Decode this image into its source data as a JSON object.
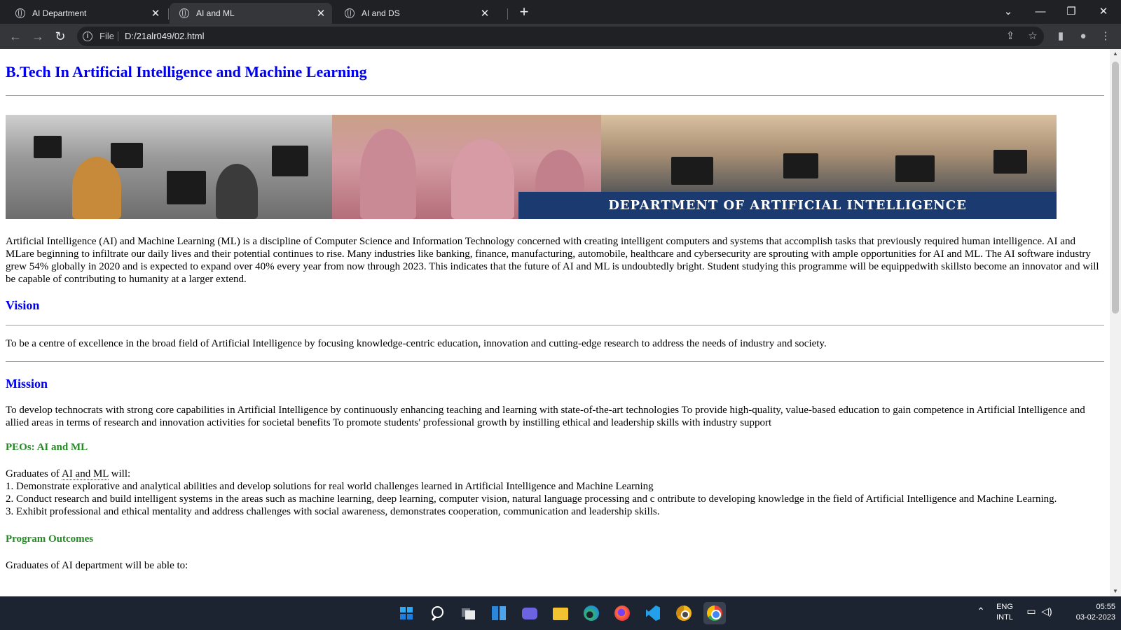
{
  "tabs": [
    {
      "label": "AI Department",
      "active": false
    },
    {
      "label": "AI and ML",
      "active": true
    },
    {
      "label": "AI and DS",
      "active": false
    }
  ],
  "toolbar": {
    "scheme": "File",
    "url": "D:/21alr049/02.html"
  },
  "page": {
    "title": "B.Tech In Artificial Intelligence and Machine Learning",
    "banner_caption": "DEPARTMENT OF ARTIFICIAL INTELLIGENCE",
    "intro": "Artificial Intelligence (AI) and Machine Learning (ML) is a discipline of Computer Science and Information Technology concerned with creating intelligent computers and systems that accomplish tasks that previously required human intelligence. AI and MLare beginning to infiltrate our daily lives and their potential continues to rise. Many industries like banking, finance, manufacturing, automobile, healthcare and cybersecurity are sprouting with ample opportunities for AI and ML. The AI software industry grew 54% globally in 2020 and is expected to expand over 40% every year from now through 2023. This indicates that the future of AI and ML is undoubtedly bright. Student studying this programme will be equippedwith skillsto become an innovator and will be capable of contributing to humanity at a larger extend.",
    "vision_heading": "Vision",
    "vision_text": "To be a centre of excellence in the broad field of Artificial Intelligence by focusing knowledge-centric education, innovation and cutting-edge research to address the needs of industry and society.",
    "mission_heading": "Mission",
    "mission_text": "To develop technocrats with strong core capabilities in Artificial Intelligence by continuously enhancing teaching and learning with state-of-the-art technologies To provide high-quality, value-based education to gain competence in Artificial Intelligence and allied areas in terms of research and innovation activities for societal benefits To promote students' professional growth by instilling ethical and leadership skills with industry support",
    "peo_heading": "PEOs: AI and ML",
    "peo_intro_prefix": "Graduates of ",
    "peo_intro_abbr": "AI and ML",
    "peo_intro_suffix": " will:",
    "peo_items": [
      "1. Demonstrate explorative and analytical abilities and develop solutions for real world challenges learned in Artificial Intelligence and Machine Learning",
      "2. Conduct research and build intelligent systems in the areas such as machine learning, deep learning, computer vision, natural language processing and c ontribute to developing knowledge in the field of Artificial Intelligence and Machine Learning.",
      "3. Exhibit professional and ethical mentality and address challenges with social awareness, demonstrates cooperation, communication and leadership skills."
    ],
    "po_heading": "Program Outcomes",
    "po_intro": "Graduates of AI department will be able to:"
  },
  "taskbar": {
    "apps": [
      "start-icon",
      "search-icon",
      "task-view-icon",
      "widgets-icon",
      "chat-icon",
      "file-explorer-icon",
      "edge-icon",
      "firefox-icon",
      "vscode-icon",
      "chrome-canary-icon",
      "chrome-icon"
    ],
    "lang_top": "ENG",
    "lang_bottom": "INTL",
    "time": "05:55",
    "date": "03-02-2023"
  }
}
